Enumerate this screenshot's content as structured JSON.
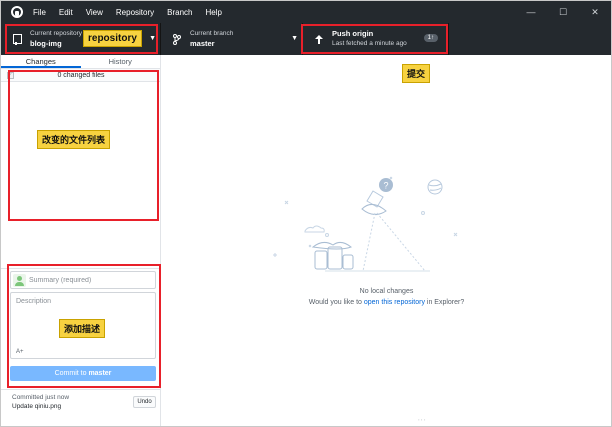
{
  "menu": {
    "items": [
      "File",
      "Edit",
      "View",
      "Repository",
      "Branch",
      "Help"
    ]
  },
  "window_controls": {
    "minimize": "—",
    "maximize": "☐",
    "close": "✕"
  },
  "toolbar": {
    "repo_caption": "Current repository",
    "repo_value": "blog-img",
    "branch_caption": "Current branch",
    "branch_value": "master",
    "push_caption": "Push origin",
    "push_status": "Last fetched a minute ago",
    "push_badge": "1↑"
  },
  "sidebar": {
    "tabs": [
      "Changes",
      "History"
    ],
    "changed_files": "0 changed files",
    "summary_placeholder": "Summary (required)",
    "description_placeholder": "Description",
    "coauthor_label": "A+",
    "commit_prefix": "Commit to ",
    "commit_branch": "master",
    "last_commit_time": "Committed just now",
    "last_commit_message": "Update qiniu.png",
    "undo_label": "Undo"
  },
  "main": {
    "empty_title": "No local changes",
    "empty_sub_prefix": "Would you like to ",
    "empty_sub_link": "open this repository",
    "empty_sub_suffix": " in Explorer?"
  },
  "annotations": {
    "repository": "repository",
    "file_list": "改变的文件列表",
    "description": "添加描述",
    "commit": "提交"
  },
  "colors": {
    "toolbar_bg": "#24292e",
    "accent": "#0366d6",
    "commit_button": "#79b8ff",
    "annotation_border": "#e8202a",
    "annotation_fill": "#f7d240"
  }
}
